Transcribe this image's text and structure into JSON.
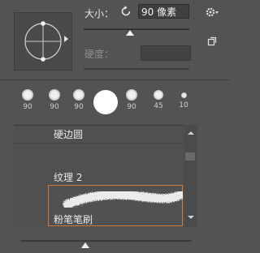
{
  "brush": {
    "size_label": "大小：",
    "size_value": "90 像素",
    "hardness_label": "硬度："
  },
  "presets": [
    {
      "value": "90"
    },
    {
      "value": "90"
    },
    {
      "value": "90"
    },
    {
      "value": ""
    },
    {
      "value": "90"
    },
    {
      "value": "45"
    },
    {
      "value": "10"
    }
  ],
  "brush_list": {
    "items": [
      {
        "label": "硬边圆"
      },
      {
        "label": "纹理 2"
      },
      {
        "label": "粉笔笔刷"
      }
    ]
  },
  "icons": {
    "reset": "reset-icon",
    "gear": "gear-icon",
    "new_preset": "new-preset-icon"
  }
}
